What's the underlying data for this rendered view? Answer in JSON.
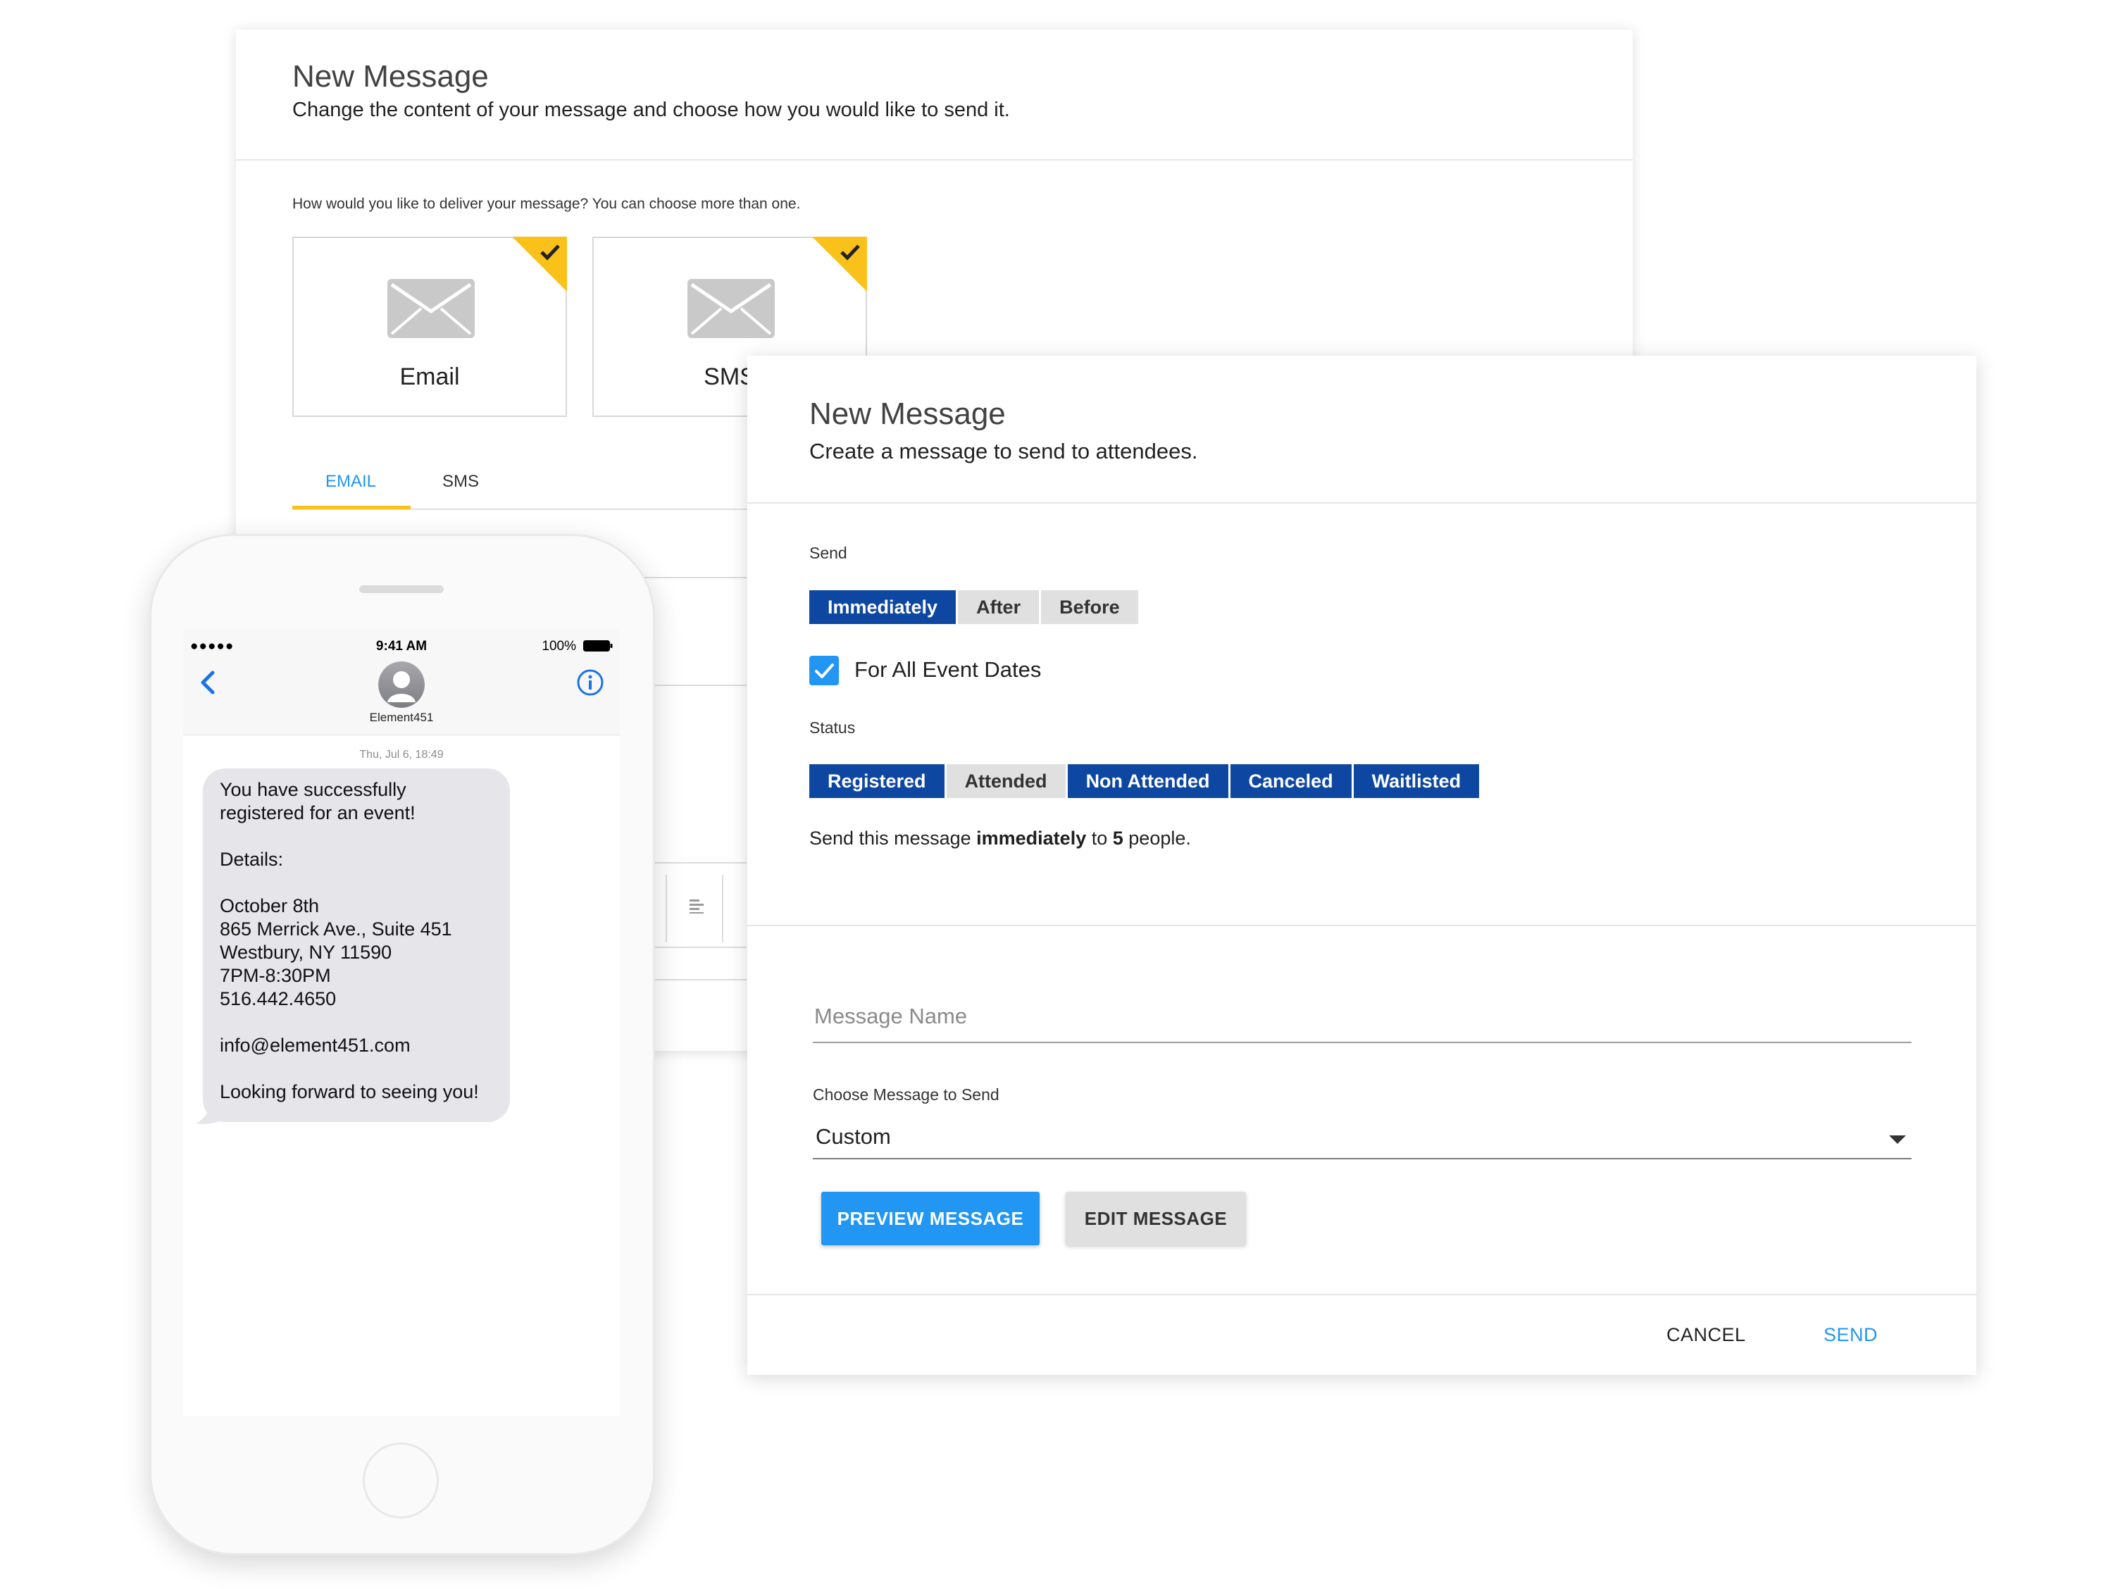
{
  "back_card": {
    "title": "New Message",
    "subtitle": "Change the content of your message and choose how you would like to send it.",
    "delivery_question": "How would you like to deliver your message? You can choose more than one.",
    "delivery_options": [
      {
        "label": "Email",
        "icon": "envelope-icon",
        "selected": true
      },
      {
        "label": "SMS",
        "icon": "envelope-icon",
        "selected": true
      }
    ],
    "tabs": [
      {
        "label": "EMAIL",
        "active": true
      },
      {
        "label": "SMS",
        "active": false
      }
    ]
  },
  "phone": {
    "status": {
      "signal": "●●●●● ",
      "time": "9:41 AM",
      "battery": "100%"
    },
    "contact_name": "Element451",
    "message_date": "Thu, Jul 6, 18:49",
    "message_lines": [
      "You have successfully",
      "registered for an event!",
      "",
      "Details:",
      "",
      "October 8th",
      "865 Merrick Ave., Suite 451",
      "Westbury, NY 11590",
      "7PM-8:30PM",
      "516.442.4650",
      "",
      "info@element451.com",
      "",
      "Looking forward to seeing you!"
    ]
  },
  "front_card": {
    "title": "New Message",
    "subtitle": "Create a message to send to attendees.",
    "send_label": "Send",
    "send_options": [
      {
        "label": "Immediately",
        "selected": true
      },
      {
        "label": "After",
        "selected": false
      },
      {
        "label": "Before",
        "selected": false
      }
    ],
    "all_dates_label": "For All Event Dates",
    "all_dates_checked": true,
    "status_label": "Status",
    "status_options": [
      {
        "label": "Registered",
        "selected": true
      },
      {
        "label": "Attended",
        "selected": false
      },
      {
        "label": "Non Attended",
        "selected": true
      },
      {
        "label": "Canceled",
        "selected": true
      },
      {
        "label": "Waitlisted",
        "selected": true
      }
    ],
    "summary_prefix": "Send this message ",
    "summary_timing": "immediately",
    "summary_middle": " to ",
    "summary_count": "5",
    "summary_suffix": " people.",
    "message_name_placeholder": "Message Name",
    "choose_label": "Choose Message to Send",
    "choose_value": "Custom",
    "preview_button": "PREVIEW MESSAGE",
    "edit_button": "EDIT MESSAGE",
    "cancel_button": "CANCEL",
    "send_button": "SEND"
  },
  "colors": {
    "primary_dark": "#0d47a1",
    "primary": "#2196f3",
    "accent_yellow": "#f9c11a",
    "segment_off": "#e0e0e0"
  }
}
